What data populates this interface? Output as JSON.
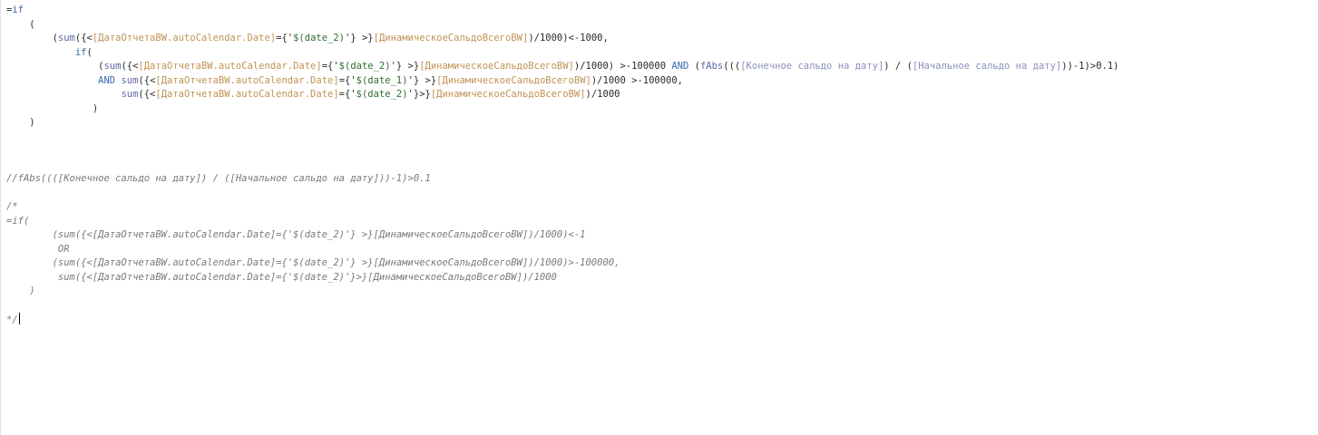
{
  "editor": {
    "lines": [
      [
        {
          "t": "=",
          "c": "p"
        },
        {
          "t": "if",
          "c": "kw"
        }
      ],
      [
        {
          "t": "    (",
          "c": "p"
        }
      ],
      [
        {
          "t": "        (",
          "c": "p"
        },
        {
          "t": "sum",
          "c": "fn"
        },
        {
          "t": "({<",
          "c": "p"
        },
        {
          "t": "[ДатаОтчетаBW.autoCalendar.Date]",
          "c": "fld"
        },
        {
          "t": "={'",
          "c": "p"
        },
        {
          "t": "$(date_2)",
          "c": "str"
        },
        {
          "t": "'} >}",
          "c": "p"
        },
        {
          "t": "[ДинамическоеСальдоВсегоBW]",
          "c": "fld"
        },
        {
          "t": ")/1000)<-1000,",
          "c": "p"
        }
      ],
      [
        {
          "t": "            ",
          "c": "p"
        },
        {
          "t": "if",
          "c": "kw"
        },
        {
          "t": "(",
          "c": "p"
        }
      ],
      [
        {
          "t": "                (",
          "c": "p"
        },
        {
          "t": "sum",
          "c": "fn"
        },
        {
          "t": "({<",
          "c": "p"
        },
        {
          "t": "[ДатаОтчетаBW.autoCalendar.Date]",
          "c": "fld"
        },
        {
          "t": "={'",
          "c": "p"
        },
        {
          "t": "$(date_2)",
          "c": "str"
        },
        {
          "t": "'} >}",
          "c": "p"
        },
        {
          "t": "[ДинамическоеСальдоВсегоBW]",
          "c": "fld"
        },
        {
          "t": ")/1000) >-100000 ",
          "c": "p"
        },
        {
          "t": "AND",
          "c": "kw"
        },
        {
          "t": " (",
          "c": "p"
        },
        {
          "t": "fAbs",
          "c": "fn"
        },
        {
          "t": "(((",
          "c": "p"
        },
        {
          "t": "[Конечное сальдо на дату]",
          "c": "cfld"
        },
        {
          "t": ") / (",
          "c": "p"
        },
        {
          "t": "[Начальное сальдо на дату]",
          "c": "cfld"
        },
        {
          "t": "))-1)>0.1)",
          "c": "p"
        }
      ],
      [
        {
          "t": "                ",
          "c": "p"
        },
        {
          "t": "AND",
          "c": "kw"
        },
        {
          "t": " ",
          "c": "p"
        },
        {
          "t": "sum",
          "c": "fn"
        },
        {
          "t": "({<",
          "c": "p"
        },
        {
          "t": "[ДатаОтчетаBW.autoCalendar.Date]",
          "c": "fld"
        },
        {
          "t": "={'",
          "c": "p"
        },
        {
          "t": "$(date_1)",
          "c": "str"
        },
        {
          "t": "'} >}",
          "c": "p"
        },
        {
          "t": "[ДинамическоеСальдоВсегоBW]",
          "c": "fld"
        },
        {
          "t": ")/1000 >-100000,",
          "c": "p"
        }
      ],
      [
        {
          "t": "                    ",
          "c": "p"
        },
        {
          "t": "sum",
          "c": "fn"
        },
        {
          "t": "({<",
          "c": "p"
        },
        {
          "t": "[ДатаОтчетаBW.autoCalendar.Date]",
          "c": "fld"
        },
        {
          "t": "={'",
          "c": "p"
        },
        {
          "t": "$(date_2)",
          "c": "str"
        },
        {
          "t": "'}>}",
          "c": "p"
        },
        {
          "t": "[ДинамическоеСальдоВсегоBW]",
          "c": "fld"
        },
        {
          "t": ")/1000",
          "c": "p"
        }
      ],
      [
        {
          "t": "               )",
          "c": "p"
        }
      ],
      [
        {
          "t": "    )",
          "c": "p"
        }
      ],
      [],
      [],
      [],
      [
        {
          "t": "//fAbs((([Конечное сальдо на дату]) / ([Начальное сальдо на дату]))-1)>0.1",
          "c": "cmt"
        }
      ],
      [],
      [
        {
          "t": "/*",
          "c": "cmt"
        }
      ],
      [
        {
          "t": "=if(",
          "c": "cmt"
        }
      ],
      [
        {
          "t": "        (sum({<[ДатаОтчетаBW.autoCalendar.Date]={'$(date_2)'} >}[ДинамическоеСальдоВсегоBW])/1000)<-1",
          "c": "cmt"
        }
      ],
      [
        {
          "t": "         OR",
          "c": "cmt"
        }
      ],
      [
        {
          "t": "        (sum({<[ДатаОтчетаBW.autoCalendar.Date]={'$(date_2)'} >}[ДинамическоеСальдоВсегоBW])/1000)>-100000,",
          "c": "cmt"
        }
      ],
      [
        {
          "t": "         sum({<[ДатаОтчетаBW.autoCalendar.Date]={'$(date_2)'}>}[ДинамическоеСальдоВсегоBW])/1000",
          "c": "cmt"
        }
      ],
      [
        {
          "t": "    )",
          "c": "cmt"
        }
      ],
      [],
      [
        {
          "t": "*/",
          "c": "cmt"
        }
      ]
    ],
    "caret_line": 22
  }
}
